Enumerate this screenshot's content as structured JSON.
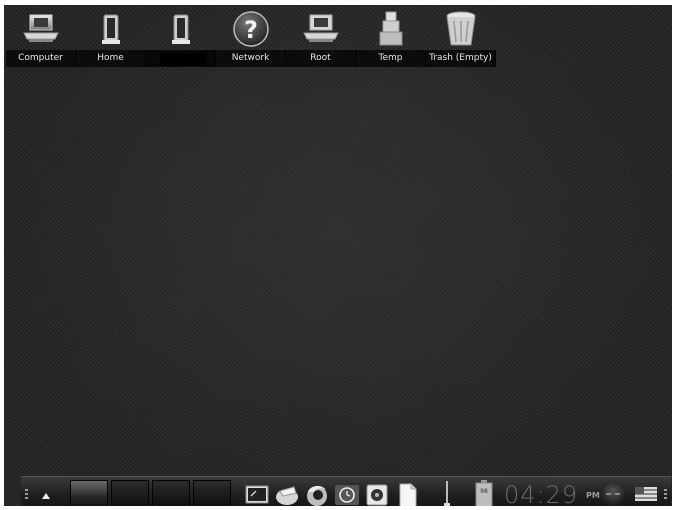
{
  "desktop": {
    "icons": [
      {
        "label": "Computer",
        "icon": "computer-icon"
      },
      {
        "label": "Home",
        "icon": "home-door-icon"
      },
      {
        "label": "",
        "icon": "folder-door-icon",
        "redacted": true
      },
      {
        "label": "Network",
        "icon": "network-question-icon"
      },
      {
        "label": "Root",
        "icon": "root-computer-icon"
      },
      {
        "label": "Temp",
        "icon": "temp-boxes-icon"
      },
      {
        "label": "Trash (Empty)",
        "icon": "trash-empty-icon"
      }
    ]
  },
  "panel": {
    "show_menu_icon": "arrow-up-icon",
    "virtual_desktops": [
      {
        "active": true
      },
      {
        "active": false
      },
      {
        "active": false
      },
      {
        "active": false
      }
    ],
    "launchers": [
      "terminal-icon",
      "ink-brush-icon",
      "firefox-icon",
      "clock-app-icon",
      "speaker-icon",
      "document-icon"
    ],
    "tray": {
      "mixer_icon": "mixer-slider-icon",
      "battery_icon": "battery-icon",
      "battery_label": "98",
      "clock_time": "04:29",
      "clock_ampm": "PM",
      "network_icon": "network-monitor-icon",
      "flag_icon": "us-flag-icon"
    }
  }
}
